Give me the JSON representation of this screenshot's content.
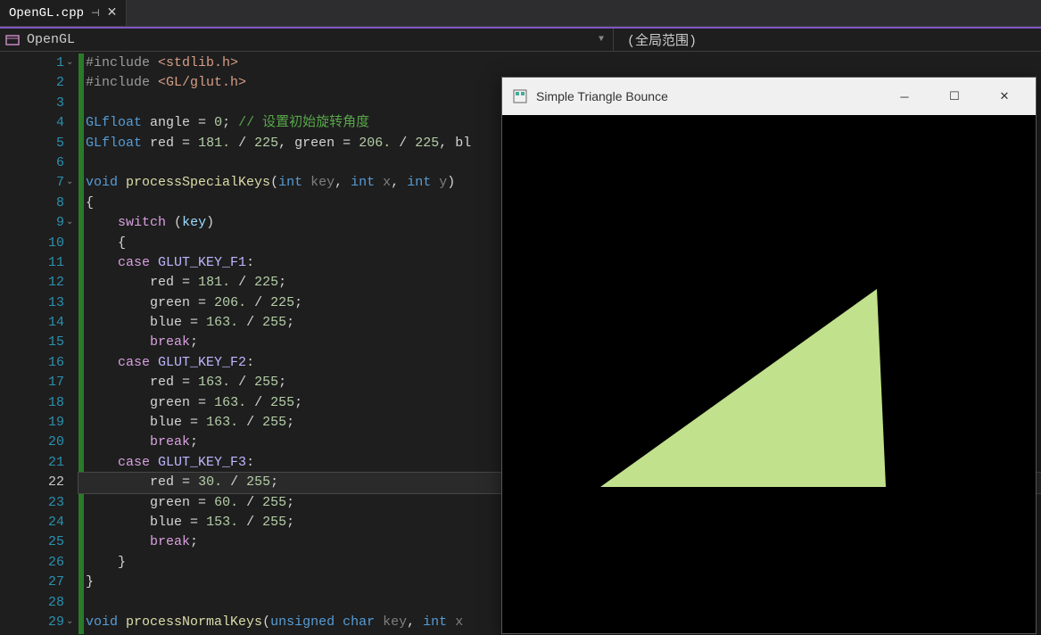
{
  "tab": {
    "filename": "OpenGL.cpp",
    "pin_icon": "⊣",
    "close_icon": "✕"
  },
  "nav": {
    "scope_class": "OpenGL",
    "scope_right": "(全局范围)"
  },
  "output": {
    "title": "Simple Triangle Bounce",
    "triangle_color": "#c1e18c"
  },
  "code": {
    "lines": [
      {
        "n": 1,
        "fold": "⌄",
        "tokens": [
          {
            "t": "#include ",
            "c": "c-directive"
          },
          {
            "t": "<stdlib.h>",
            "c": "c-string"
          }
        ]
      },
      {
        "n": 2,
        "tokens": [
          {
            "t": "#include ",
            "c": "c-directive"
          },
          {
            "t": "<GL/glut.h>",
            "c": "c-string"
          }
        ]
      },
      {
        "n": 3,
        "tokens": []
      },
      {
        "n": 4,
        "tokens": [
          {
            "t": "GLfloat",
            "c": "c-type"
          },
          {
            "t": " angle ",
            "c": "c-punct"
          },
          {
            "t": "=",
            "c": "c-punct"
          },
          {
            "t": " ",
            "c": ""
          },
          {
            "t": "0",
            "c": "c-number"
          },
          {
            "t": ";",
            "c": "c-punct"
          },
          {
            "t": " ",
            "c": ""
          },
          {
            "t": "// 设置初始旋转角度",
            "c": "c-comment"
          }
        ]
      },
      {
        "n": 5,
        "tokens": [
          {
            "t": "GLfloat",
            "c": "c-type"
          },
          {
            "t": " red ",
            "c": "c-punct"
          },
          {
            "t": "=",
            "c": "c-punct"
          },
          {
            "t": " ",
            "c": ""
          },
          {
            "t": "181.",
            "c": "c-number"
          },
          {
            "t": " ",
            "c": ""
          },
          {
            "t": "/",
            "c": "c-punct"
          },
          {
            "t": " ",
            "c": ""
          },
          {
            "t": "225",
            "c": "c-number"
          },
          {
            "t": ", green ",
            "c": "c-punct"
          },
          {
            "t": "=",
            "c": "c-punct"
          },
          {
            "t": " ",
            "c": ""
          },
          {
            "t": "206.",
            "c": "c-number"
          },
          {
            "t": " ",
            "c": ""
          },
          {
            "t": "/",
            "c": "c-punct"
          },
          {
            "t": " ",
            "c": ""
          },
          {
            "t": "225",
            "c": "c-number"
          },
          {
            "t": ", bl",
            "c": "c-punct"
          }
        ]
      },
      {
        "n": 6,
        "tokens": []
      },
      {
        "n": 7,
        "fold": "⌄",
        "tokens": [
          {
            "t": "void",
            "c": "c-type"
          },
          {
            "t": " ",
            "c": ""
          },
          {
            "t": "processSpecialKeys",
            "c": "c-func"
          },
          {
            "t": "(",
            "c": "c-paren"
          },
          {
            "t": "int",
            "c": "c-type"
          },
          {
            "t": " ",
            "c": ""
          },
          {
            "t": "key",
            "c": "c-param"
          },
          {
            "t": ", ",
            "c": "c-punct"
          },
          {
            "t": "int",
            "c": "c-type"
          },
          {
            "t": " ",
            "c": ""
          },
          {
            "t": "x",
            "c": "c-param"
          },
          {
            "t": ", ",
            "c": "c-punct"
          },
          {
            "t": "int",
            "c": "c-type"
          },
          {
            "t": " ",
            "c": ""
          },
          {
            "t": "y",
            "c": "c-param"
          },
          {
            "t": ")",
            "c": "c-paren"
          }
        ]
      },
      {
        "n": 8,
        "tokens": [
          {
            "t": "{",
            "c": "c-brace"
          }
        ]
      },
      {
        "n": 9,
        "fold": "⌄",
        "tokens": [
          {
            "t": "    ",
            "c": ""
          },
          {
            "t": "switch",
            "c": "c-keyword"
          },
          {
            "t": " ",
            "c": ""
          },
          {
            "t": "(",
            "c": "c-paren"
          },
          {
            "t": "key",
            "c": "c-ident"
          },
          {
            "t": ")",
            "c": "c-paren"
          }
        ]
      },
      {
        "n": 10,
        "tokens": [
          {
            "t": "    ",
            "c": ""
          },
          {
            "t": "{",
            "c": "c-brace"
          }
        ]
      },
      {
        "n": 11,
        "tokens": [
          {
            "t": "    ",
            "c": ""
          },
          {
            "t": "case",
            "c": "c-keyword"
          },
          {
            "t": " ",
            "c": ""
          },
          {
            "t": "GLUT_KEY_F1",
            "c": "c-macro"
          },
          {
            "t": ":",
            "c": "c-punct"
          }
        ]
      },
      {
        "n": 12,
        "tokens": [
          {
            "t": "        red ",
            "c": "c-punct"
          },
          {
            "t": "=",
            "c": "c-punct"
          },
          {
            "t": " ",
            "c": ""
          },
          {
            "t": "181.",
            "c": "c-number"
          },
          {
            "t": " ",
            "c": ""
          },
          {
            "t": "/",
            "c": "c-punct"
          },
          {
            "t": " ",
            "c": ""
          },
          {
            "t": "225",
            "c": "c-number"
          },
          {
            "t": ";",
            "c": "c-punct"
          }
        ]
      },
      {
        "n": 13,
        "tokens": [
          {
            "t": "        green ",
            "c": "c-punct"
          },
          {
            "t": "=",
            "c": "c-punct"
          },
          {
            "t": " ",
            "c": ""
          },
          {
            "t": "206.",
            "c": "c-number"
          },
          {
            "t": " ",
            "c": ""
          },
          {
            "t": "/",
            "c": "c-punct"
          },
          {
            "t": " ",
            "c": ""
          },
          {
            "t": "225",
            "c": "c-number"
          },
          {
            "t": ";",
            "c": "c-punct"
          }
        ]
      },
      {
        "n": 14,
        "tokens": [
          {
            "t": "        blue ",
            "c": "c-punct"
          },
          {
            "t": "=",
            "c": "c-punct"
          },
          {
            "t": " ",
            "c": ""
          },
          {
            "t": "163.",
            "c": "c-number"
          },
          {
            "t": " ",
            "c": ""
          },
          {
            "t": "/",
            "c": "c-punct"
          },
          {
            "t": " ",
            "c": ""
          },
          {
            "t": "255",
            "c": "c-number"
          },
          {
            "t": ";",
            "c": "c-punct"
          }
        ]
      },
      {
        "n": 15,
        "tokens": [
          {
            "t": "        ",
            "c": ""
          },
          {
            "t": "break",
            "c": "c-keyword"
          },
          {
            "t": ";",
            "c": "c-punct"
          }
        ]
      },
      {
        "n": 16,
        "tokens": [
          {
            "t": "    ",
            "c": ""
          },
          {
            "t": "case",
            "c": "c-keyword"
          },
          {
            "t": " ",
            "c": ""
          },
          {
            "t": "GLUT_KEY_F2",
            "c": "c-macro"
          },
          {
            "t": ":",
            "c": "c-punct"
          }
        ]
      },
      {
        "n": 17,
        "tokens": [
          {
            "t": "        red ",
            "c": "c-punct"
          },
          {
            "t": "=",
            "c": "c-punct"
          },
          {
            "t": " ",
            "c": ""
          },
          {
            "t": "163.",
            "c": "c-number"
          },
          {
            "t": " ",
            "c": ""
          },
          {
            "t": "/",
            "c": "c-punct"
          },
          {
            "t": " ",
            "c": ""
          },
          {
            "t": "255",
            "c": "c-number"
          },
          {
            "t": ";",
            "c": "c-punct"
          }
        ]
      },
      {
        "n": 18,
        "tokens": [
          {
            "t": "        green ",
            "c": "c-punct"
          },
          {
            "t": "=",
            "c": "c-punct"
          },
          {
            "t": " ",
            "c": ""
          },
          {
            "t": "163.",
            "c": "c-number"
          },
          {
            "t": " ",
            "c": ""
          },
          {
            "t": "/",
            "c": "c-punct"
          },
          {
            "t": " ",
            "c": ""
          },
          {
            "t": "255",
            "c": "c-number"
          },
          {
            "t": ";",
            "c": "c-punct"
          }
        ]
      },
      {
        "n": 19,
        "tokens": [
          {
            "t": "        blue ",
            "c": "c-punct"
          },
          {
            "t": "=",
            "c": "c-punct"
          },
          {
            "t": " ",
            "c": ""
          },
          {
            "t": "163.",
            "c": "c-number"
          },
          {
            "t": " ",
            "c": ""
          },
          {
            "t": "/",
            "c": "c-punct"
          },
          {
            "t": " ",
            "c": ""
          },
          {
            "t": "255",
            "c": "c-number"
          },
          {
            "t": ";",
            "c": "c-punct"
          }
        ]
      },
      {
        "n": 20,
        "tokens": [
          {
            "t": "        ",
            "c": ""
          },
          {
            "t": "break",
            "c": "c-keyword"
          },
          {
            "t": ";",
            "c": "c-punct"
          }
        ]
      },
      {
        "n": 21,
        "tokens": [
          {
            "t": "    ",
            "c": ""
          },
          {
            "t": "case",
            "c": "c-keyword"
          },
          {
            "t": " ",
            "c": ""
          },
          {
            "t": "GLUT_KEY_F3",
            "c": "c-macro"
          },
          {
            "t": ":",
            "c": "c-punct"
          }
        ]
      },
      {
        "n": 22,
        "current": true,
        "tokens": [
          {
            "t": "        red ",
            "c": "c-punct"
          },
          {
            "t": "=",
            "c": "c-punct"
          },
          {
            "t": " ",
            "c": ""
          },
          {
            "t": "30.",
            "c": "c-number"
          },
          {
            "t": " ",
            "c": ""
          },
          {
            "t": "/",
            "c": "c-punct"
          },
          {
            "t": " ",
            "c": ""
          },
          {
            "t": "255",
            "c": "c-number"
          },
          {
            "t": ";",
            "c": "c-punct"
          }
        ]
      },
      {
        "n": 23,
        "tokens": [
          {
            "t": "        green ",
            "c": "c-punct"
          },
          {
            "t": "=",
            "c": "c-punct"
          },
          {
            "t": " ",
            "c": ""
          },
          {
            "t": "60.",
            "c": "c-number"
          },
          {
            "t": " ",
            "c": ""
          },
          {
            "t": "/",
            "c": "c-punct"
          },
          {
            "t": " ",
            "c": ""
          },
          {
            "t": "255",
            "c": "c-number"
          },
          {
            "t": ";",
            "c": "c-punct"
          }
        ]
      },
      {
        "n": 24,
        "tokens": [
          {
            "t": "        blue ",
            "c": "c-punct"
          },
          {
            "t": "=",
            "c": "c-punct"
          },
          {
            "t": " ",
            "c": ""
          },
          {
            "t": "153.",
            "c": "c-number"
          },
          {
            "t": " ",
            "c": ""
          },
          {
            "t": "/",
            "c": "c-punct"
          },
          {
            "t": " ",
            "c": ""
          },
          {
            "t": "255",
            "c": "c-number"
          },
          {
            "t": ";",
            "c": "c-punct"
          }
        ]
      },
      {
        "n": 25,
        "tokens": [
          {
            "t": "        ",
            "c": ""
          },
          {
            "t": "break",
            "c": "c-keyword"
          },
          {
            "t": ";",
            "c": "c-punct"
          }
        ]
      },
      {
        "n": 26,
        "tokens": [
          {
            "t": "    ",
            "c": ""
          },
          {
            "t": "}",
            "c": "c-brace"
          }
        ]
      },
      {
        "n": 27,
        "tokens": [
          {
            "t": "}",
            "c": "c-brace"
          }
        ]
      },
      {
        "n": 28,
        "tokens": []
      },
      {
        "n": 29,
        "fold": "⌄",
        "tokens": [
          {
            "t": "void",
            "c": "c-type"
          },
          {
            "t": " ",
            "c": ""
          },
          {
            "t": "processNormalKeys",
            "c": "c-func"
          },
          {
            "t": "(",
            "c": "c-paren"
          },
          {
            "t": "unsigned",
            "c": "c-type"
          },
          {
            "t": " ",
            "c": ""
          },
          {
            "t": "char",
            "c": "c-type"
          },
          {
            "t": " ",
            "c": ""
          },
          {
            "t": "key",
            "c": "c-param"
          },
          {
            "t": ", ",
            "c": "c-punct"
          },
          {
            "t": "int",
            "c": "c-type"
          },
          {
            "t": " ",
            "c": ""
          },
          {
            "t": "x",
            "c": "c-param"
          }
        ]
      }
    ]
  }
}
